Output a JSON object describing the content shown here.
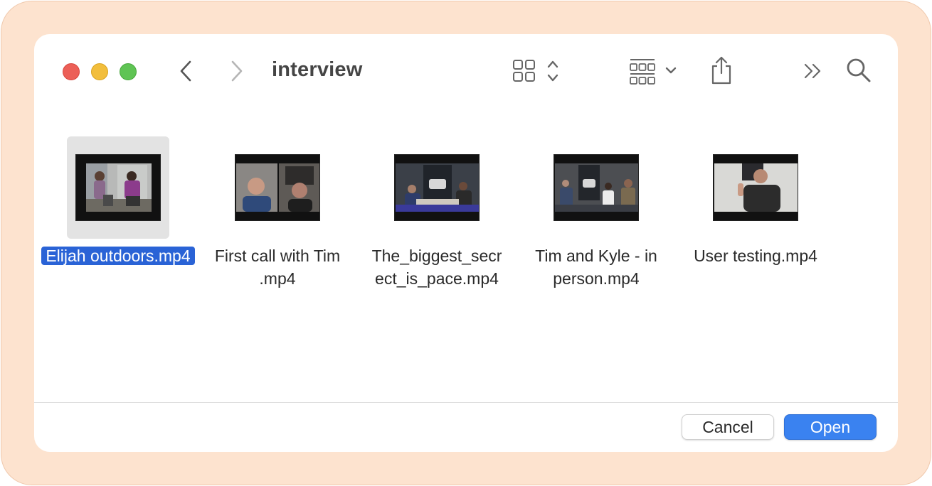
{
  "window": {
    "folder_title": "interview"
  },
  "toolbar": {
    "icons": [
      "chevron-left-icon",
      "chevron-right-icon",
      "icon-grid-icon",
      "group-by-icon",
      "share-icon",
      "more-chevrons-icon",
      "search-icon"
    ]
  },
  "files": [
    {
      "name": "Elijah outdoors.mp4",
      "selected": true
    },
    {
      "name": "First call with Tim .mp4",
      "selected": false
    },
    {
      "name": "The_biggest_secr ect_is_pace.mp4",
      "selected": false
    },
    {
      "name": "Tim and Kyle - in person.mp4",
      "selected": false
    },
    {
      "name": "User testing.mp4",
      "selected": false
    }
  ],
  "buttons": {
    "cancel_label": "Cancel",
    "open_label": "Open"
  },
  "colors": {
    "frame": "#fde3cf",
    "accent": "#3a82f0",
    "selection": "#2a63d6"
  }
}
